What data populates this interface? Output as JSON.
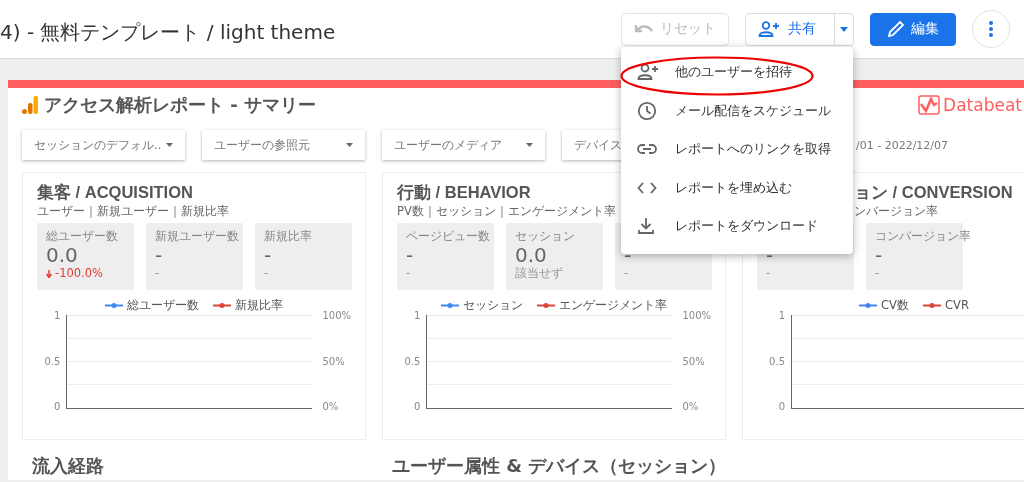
{
  "header": {
    "title": "4) - 無料テンプレート / light theme",
    "buttons": [
      {
        "kind": "reset",
        "label": "リセット",
        "disabled": true
      },
      {
        "kind": "share",
        "label": "共有",
        "disabled": false
      },
      {
        "kind": "edit",
        "label": "編集",
        "disabled": false
      },
      {
        "kind": "more",
        "disabled": false
      }
    ]
  },
  "report": {
    "title": "アクセス解析レポート - サマリー",
    "logo": "Databeat",
    "filters": [
      {
        "label": "セッションのデフォル.."
      },
      {
        "label": "ユーザーの参照元"
      },
      {
        "label": "ユーザーのメディア"
      },
      {
        "label": "デバイス"
      }
    ],
    "date_range": "/01 - 2022/12/07",
    "sections": [
      {
        "title": "集客 / ACQUISITION",
        "subtitle": "ユーザー｜新規ユーザー｜新規比率",
        "metrics": [
          {
            "label": "総ユーザー数",
            "value": "0.0",
            "delta": "-100.0%",
            "decline": true
          },
          {
            "label": "新規ユーザー数",
            "value": "-",
            "delta": "-",
            "decline": false
          },
          {
            "label": "新規比率",
            "value": "-",
            "delta": "-",
            "decline": false
          }
        ],
        "legend": [
          {
            "label": "総ユーザー数",
            "color": "#4285f4"
          },
          {
            "label": "新規比率",
            "color": "#db4437"
          }
        ],
        "y_ticks": [
          "1",
          "0.5",
          "0"
        ],
        "y2_ticks": [
          "100%",
          "50%",
          "0%"
        ]
      },
      {
        "title": "行動 / BEHAVIOR",
        "subtitle": "PV数｜セッション｜エンゲージメント率",
        "metrics": [
          {
            "label": "ページビュー数",
            "value": "-",
            "delta": "-",
            "decline": false
          },
          {
            "label": "セッション",
            "value": "0.0",
            "delta": "該当せず",
            "decline": false
          },
          {
            "value": "-",
            "delta": "-",
            "decline": false
          }
        ],
        "legend": [
          {
            "label": "セッション",
            "color": "#4285f4"
          },
          {
            "label": "エンゲージメント率",
            "color": "#db4437"
          }
        ],
        "y_ticks": [
          "1",
          "0.5",
          "0"
        ],
        "y2_ticks": [
          "100%",
          "50%",
          "0%"
        ]
      },
      {
        "title": "ョン / CONVERSION",
        "subtitle": "ンバージョン率",
        "metrics": [
          {
            "value": "-",
            "delta": "-",
            "decline": false
          },
          {
            "label": "コンバージョン率",
            "value": "-",
            "delta": "-",
            "decline": false
          }
        ],
        "legend": [
          {
            "label": "CV数",
            "color": "#4285f4"
          },
          {
            "label": "CVR",
            "color": "#db4437"
          }
        ],
        "y_ticks": [
          "1",
          "0.5",
          "0"
        ]
      }
    ],
    "bottom_titles": [
      "流入経路",
      "ユーザー属性 & デバイス（セッション）"
    ]
  },
  "share_menu": {
    "items": [
      {
        "kind": "invite",
        "label": "他のユーザーを招待",
        "highlighted": true
      },
      {
        "kind": "schedule",
        "label": "メール配信をスケジュール",
        "highlighted": false
      },
      {
        "kind": "link",
        "label": "レポートへのリンクを取得",
        "highlighted": false
      },
      {
        "kind": "embed",
        "label": "レポートを埋め込む",
        "highlighted": false
      },
      {
        "kind": "download",
        "label": "レポートをダウンロード",
        "highlighted": false
      }
    ]
  }
}
